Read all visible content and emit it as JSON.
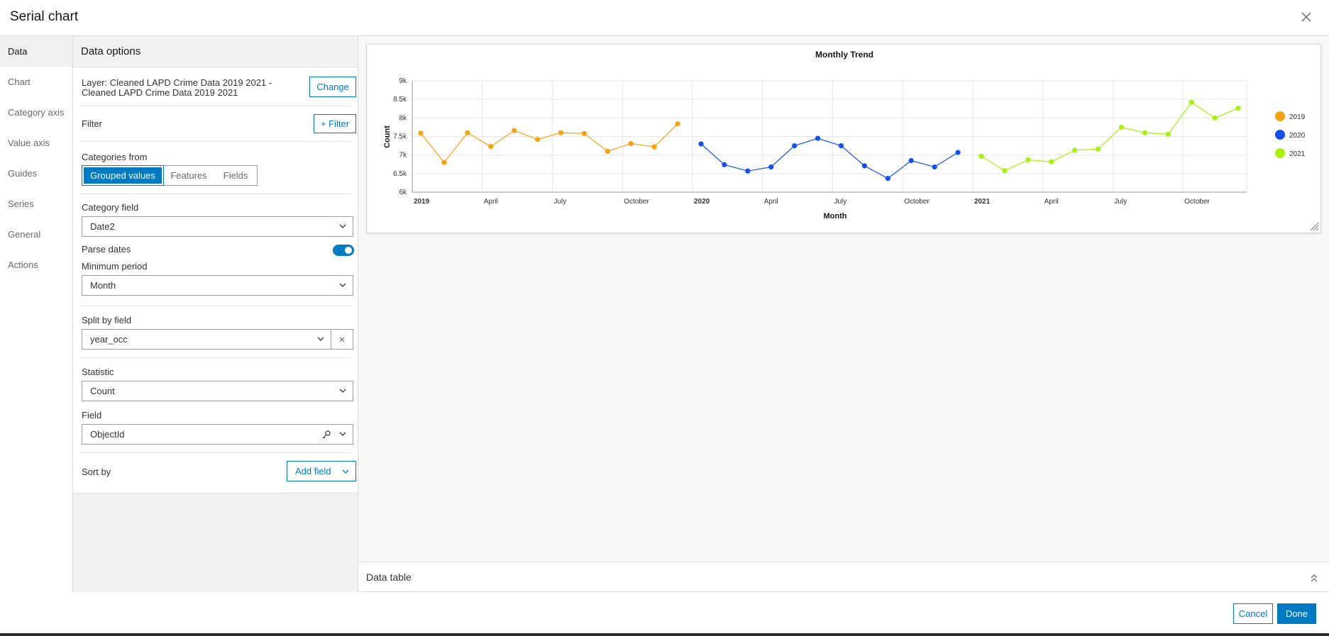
{
  "dialog": {
    "title": "Serial chart"
  },
  "nav": {
    "items": [
      {
        "label": "Data",
        "active": true
      },
      {
        "label": "Chart"
      },
      {
        "label": "Category axis"
      },
      {
        "label": "Value axis"
      },
      {
        "label": "Guides"
      },
      {
        "label": "Series"
      },
      {
        "label": "General"
      },
      {
        "label": "Actions"
      }
    ]
  },
  "options": {
    "heading": "Data options",
    "layer_line1": "Layer: Cleaned LAPD Crime Data 2019 2021 -",
    "layer_line2": "Cleaned LAPD Crime Data 2019 2021",
    "change_label": "Change",
    "filter_label": "Filter",
    "add_filter_label": "+ Filter",
    "categories_from_label": "Categories from",
    "categories_tabs": [
      "Grouped values",
      "Features",
      "Fields"
    ],
    "category_field_label": "Category field",
    "category_field_value": "Date2",
    "parse_dates_label": "Parse dates",
    "minimum_period_label": "Minimum period",
    "minimum_period_value": "Month",
    "split_by_label": "Split by field",
    "split_by_value": "year_occ",
    "statistic_label": "Statistic",
    "statistic_value": "Count",
    "field_label": "Field",
    "field_value": "ObjectId",
    "sort_by_label": "Sort by",
    "add_field_label": "Add field"
  },
  "data_table": {
    "label": "Data table"
  },
  "footer": {
    "cancel_label": "Cancel",
    "done_label": "Done"
  },
  "colors": {
    "accent": "#007ac2",
    "s2019": "#f7a30f",
    "s2020": "#1450f0",
    "s2021": "#a6f20a"
  },
  "icons": [
    "close-icon",
    "chevron-down-icon",
    "clear-icon",
    "key-icon",
    "resize-handle-icon",
    "chevron-up-double-icon"
  ],
  "chart_data": {
    "type": "line",
    "title": "Monthly Trend",
    "xlabel": "Month",
    "ylabel": "Count",
    "ylim": [
      6000,
      9000
    ],
    "y_ticks": [
      6000,
      6500,
      7000,
      7500,
      8000,
      8500,
      9000
    ],
    "y_tick_labels": [
      "6k",
      "6.5k",
      "7k",
      "7.5k",
      "8k",
      "8.5k",
      "9k"
    ],
    "x_tick_labels": [
      "2019",
      "April",
      "July",
      "October",
      "2020",
      "April",
      "July",
      "October",
      "2021",
      "April",
      "July",
      "October"
    ],
    "grid": true,
    "legend": "right",
    "series": [
      {
        "name": "2019",
        "color": "#f7a30f",
        "x": [
          "2019-01",
          "2019-02",
          "2019-03",
          "2019-04",
          "2019-05",
          "2019-06",
          "2019-07",
          "2019-08",
          "2019-09",
          "2019-10",
          "2019-11",
          "2019-12"
        ],
        "values": [
          7590,
          6800,
          7600,
          7230,
          7660,
          7420,
          7600,
          7580,
          7100,
          7310,
          7220,
          7840
        ]
      },
      {
        "name": "2020",
        "color": "#1450f0",
        "x": [
          "2020-01",
          "2020-02",
          "2020-03",
          "2020-04",
          "2020-05",
          "2020-06",
          "2020-07",
          "2020-08",
          "2020-09",
          "2020-10",
          "2020-11",
          "2020-12"
        ],
        "values": [
          7300,
          6740,
          6570,
          6680,
          7250,
          7450,
          7250,
          6710,
          6370,
          6850,
          6680,
          7070
        ]
      },
      {
        "name": "2021",
        "color": "#a6f20a",
        "x": [
          "2021-01",
          "2021-02",
          "2021-03",
          "2021-04",
          "2021-05",
          "2021-06",
          "2021-07",
          "2021-08",
          "2021-09",
          "2021-10",
          "2021-11",
          "2021-12"
        ],
        "values": [
          6970,
          6580,
          6870,
          6820,
          7130,
          7160,
          7750,
          7600,
          7560,
          8420,
          8000,
          8260
        ]
      }
    ]
  }
}
